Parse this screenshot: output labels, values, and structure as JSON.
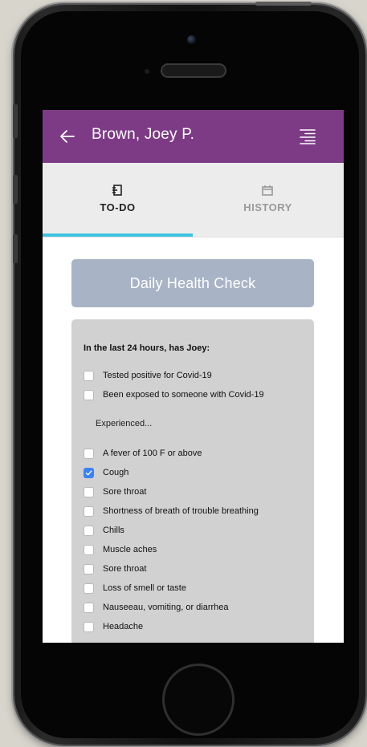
{
  "header": {
    "title": "Brown, Joey P.",
    "back_icon": "back-arrow-icon",
    "menu_icon": "list-menu-icon",
    "background": "#7d3b86"
  },
  "tabs": [
    {
      "label": "TO-DO",
      "icon": "todo-icon",
      "active": true
    },
    {
      "label": "HISTORY",
      "icon": "calendar-icon",
      "active": false
    }
  ],
  "accent": "#3ec3e0",
  "daily_check": {
    "label": "Daily Health Check"
  },
  "questionnaire": {
    "question": "In the last 24 hours, has Joey:",
    "group_a": [
      {
        "label": "Tested positive for Covid-19",
        "checked": false
      },
      {
        "label": "Been exposed to someone with Covid-19",
        "checked": false
      }
    ],
    "subheading": "Experienced...",
    "group_b": [
      {
        "label": "A fever of 100 F or above",
        "checked": false
      },
      {
        "label": "Cough",
        "checked": true
      },
      {
        "label": "Sore throat",
        "checked": false
      },
      {
        "label": "Shortness of breath of trouble breathing",
        "checked": false
      },
      {
        "label": "Chills",
        "checked": false
      },
      {
        "label": "Muscle aches",
        "checked": false
      },
      {
        "label": "Sore throat",
        "checked": false
      },
      {
        "label": "Loss of smell or taste",
        "checked": false
      },
      {
        "label": "Nauseeau, vomiting, or diarrhea",
        "checked": false
      },
      {
        "label": "Headache",
        "checked": false
      }
    ]
  }
}
